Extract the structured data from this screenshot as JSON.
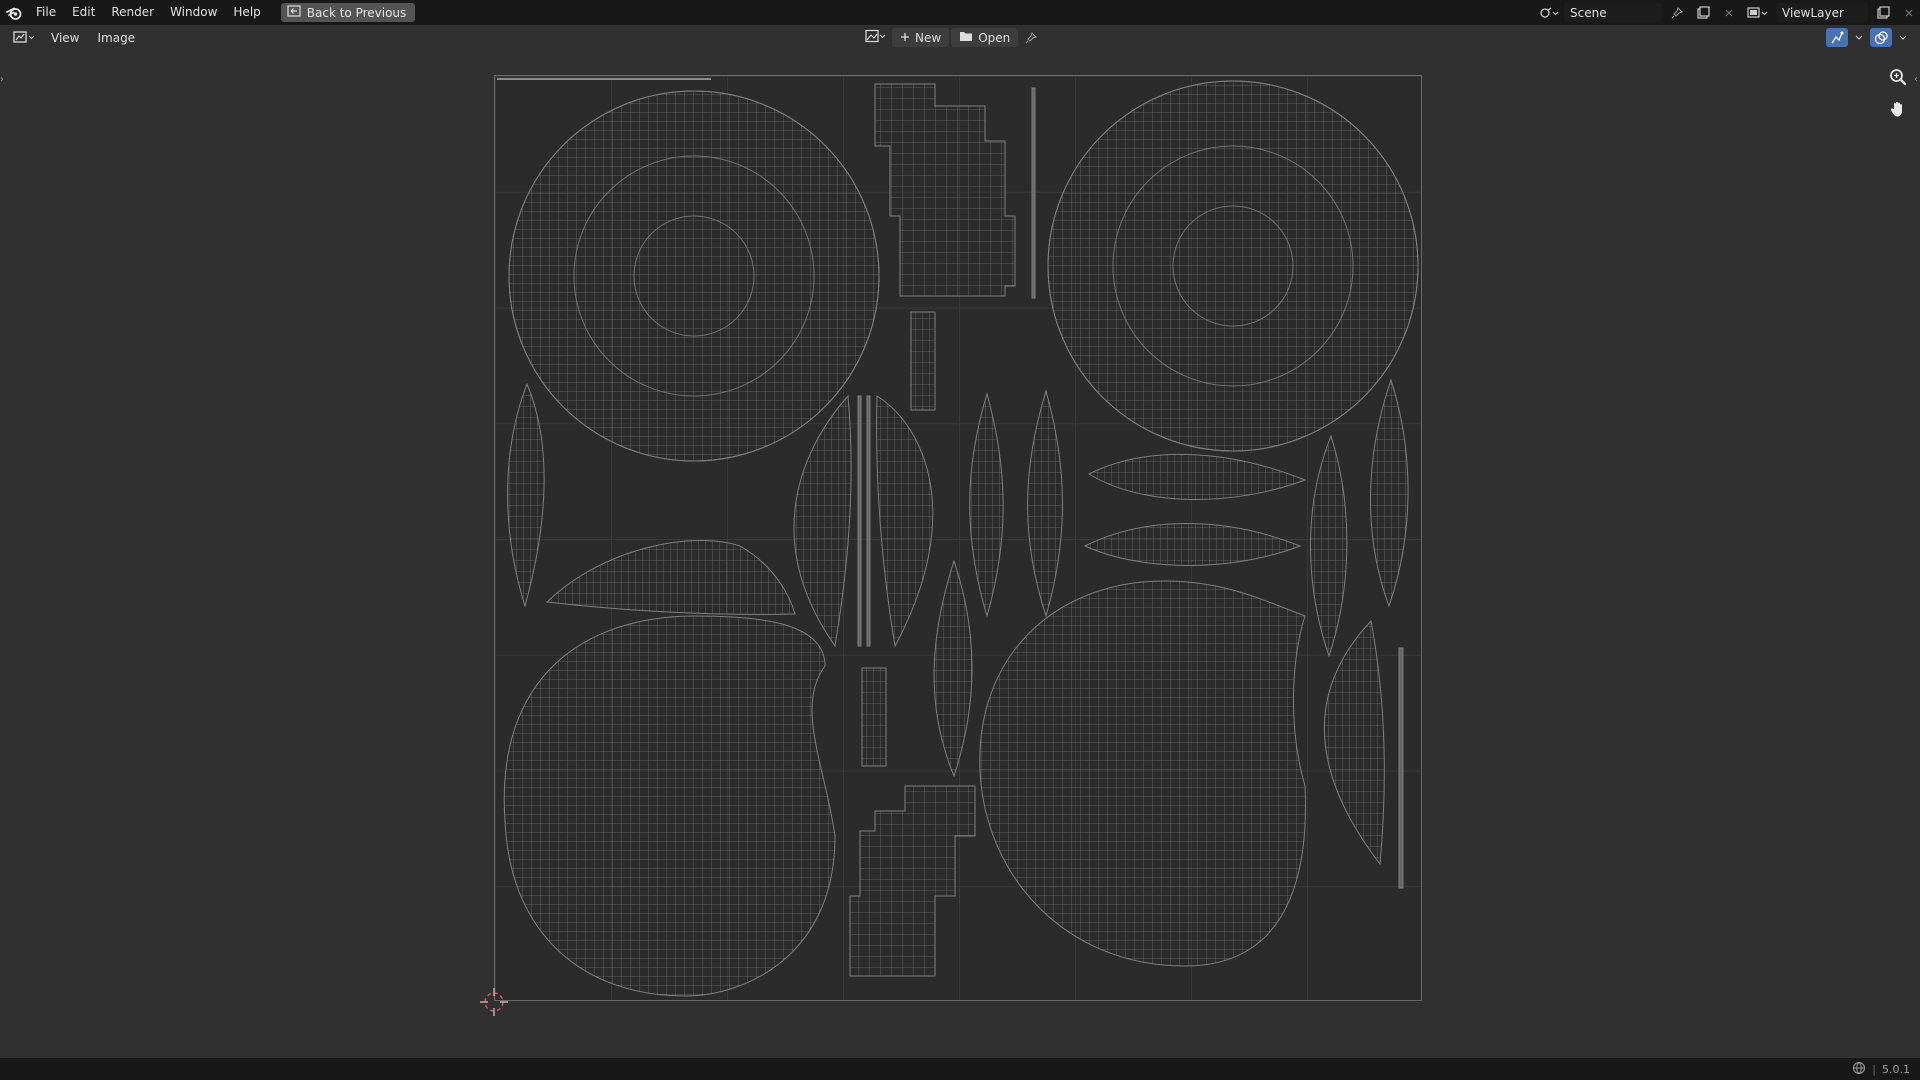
{
  "topbar": {
    "menus": [
      "File",
      "Edit",
      "Render",
      "Window",
      "Help"
    ],
    "back_button": "Back to Previous",
    "scene_name": "Scene",
    "view_layer_name": "ViewLayer"
  },
  "header": {
    "menus": [
      "View",
      "Image"
    ],
    "new_label": "New",
    "open_label": "Open"
  },
  "status": {
    "version": "5.0.1"
  },
  "colors": {
    "topbar_bg": "#181818",
    "area_bg": "#303030",
    "wire": "#7c7c7c",
    "active_icon": "#4772b3"
  },
  "icons": [
    "blender-logo-icon",
    "back-icon",
    "image-editor-icon",
    "image-icon",
    "plus-icon",
    "folder-icon",
    "pin-icon",
    "zoom-icon",
    "hand-icon",
    "uv-sync-icon",
    "overlay-icon",
    "cursor-icon",
    "network-icon"
  ]
}
